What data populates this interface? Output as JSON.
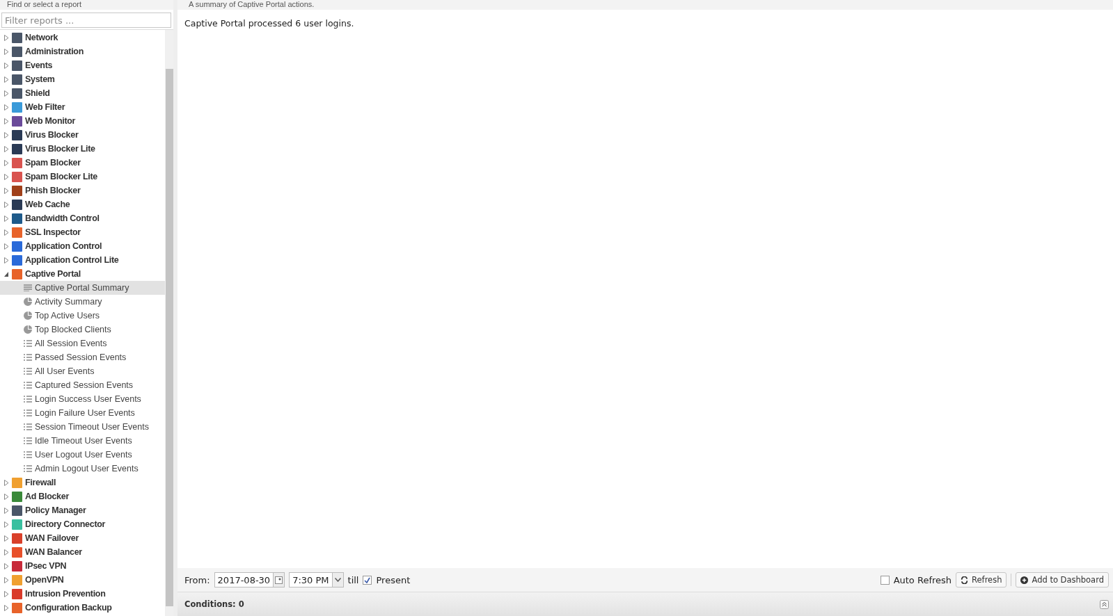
{
  "sidebar": {
    "title": "Find or select a report",
    "filter": {
      "placeholder": "Filter reports ..."
    },
    "items": [
      {
        "label": "Network",
        "color": "#4a5668",
        "expanded": false,
        "selected": false
      },
      {
        "label": "Administration",
        "color": "#4a5668",
        "expanded": false,
        "selected": false
      },
      {
        "label": "Events",
        "color": "#4a5668",
        "expanded": false,
        "selected": false
      },
      {
        "label": "System",
        "color": "#4a5668",
        "expanded": false,
        "selected": false
      },
      {
        "label": "Shield",
        "color": "#4a5668",
        "expanded": false,
        "selected": false
      },
      {
        "label": "Web Filter",
        "color": "#3a9ad9",
        "expanded": false,
        "selected": false
      },
      {
        "label": "Web Monitor",
        "color": "#6a4a9a",
        "expanded": false,
        "selected": false
      },
      {
        "label": "Virus Blocker",
        "color": "#2a3a55",
        "expanded": false,
        "selected": false
      },
      {
        "label": "Virus Blocker Lite",
        "color": "#2a3a55",
        "expanded": false,
        "selected": false
      },
      {
        "label": "Spam Blocker",
        "color": "#d9534f",
        "expanded": false,
        "selected": false
      },
      {
        "label": "Spam Blocker Lite",
        "color": "#d9534f",
        "expanded": false,
        "selected": false
      },
      {
        "label": "Phish Blocker",
        "color": "#a0401a",
        "expanded": false,
        "selected": false
      },
      {
        "label": "Web Cache",
        "color": "#2a3a55",
        "expanded": false,
        "selected": false
      },
      {
        "label": "Bandwidth Control",
        "color": "#1e5a8a",
        "expanded": false,
        "selected": false
      },
      {
        "label": "SSL Inspector",
        "color": "#e8632a",
        "expanded": false,
        "selected": false
      },
      {
        "label": "Application Control",
        "color": "#2a6ad9",
        "expanded": false,
        "selected": false
      },
      {
        "label": "Application Control Lite",
        "color": "#2a6ad9",
        "expanded": false,
        "selected": false
      },
      {
        "label": "Captive Portal",
        "color": "#e8632a",
        "expanded": true,
        "selected": false,
        "children": [
          {
            "label": "Captive Portal Summary",
            "kind": "text",
            "selected": true
          },
          {
            "label": "Activity Summary",
            "kind": "pie",
            "selected": false
          },
          {
            "label": "Top Active Users",
            "kind": "pie",
            "selected": false
          },
          {
            "label": "Top Blocked Clients",
            "kind": "pie",
            "selected": false
          },
          {
            "label": "All Session Events",
            "kind": "list",
            "selected": false
          },
          {
            "label": "Passed Session Events",
            "kind": "list",
            "selected": false
          },
          {
            "label": "All User Events",
            "kind": "list",
            "selected": false
          },
          {
            "label": "Captured Session Events",
            "kind": "list",
            "selected": false
          },
          {
            "label": "Login Success User Events",
            "kind": "list",
            "selected": false
          },
          {
            "label": "Login Failure User Events",
            "kind": "list",
            "selected": false
          },
          {
            "label": "Session Timeout User Events",
            "kind": "list",
            "selected": false
          },
          {
            "label": "Idle Timeout User Events",
            "kind": "list",
            "selected": false
          },
          {
            "label": "User Logout User Events",
            "kind": "list",
            "selected": false
          },
          {
            "label": "Admin Logout User Events",
            "kind": "list",
            "selected": false
          }
        ]
      },
      {
        "label": "Firewall",
        "color": "#f0a030",
        "expanded": false,
        "selected": false
      },
      {
        "label": "Ad Blocker",
        "color": "#3a8a3a",
        "expanded": false,
        "selected": false
      },
      {
        "label": "Policy Manager",
        "color": "#4a5668",
        "expanded": false,
        "selected": false
      },
      {
        "label": "Directory Connector",
        "color": "#3ac0a0",
        "expanded": false,
        "selected": false
      },
      {
        "label": "WAN Failover",
        "color": "#d9402a",
        "expanded": false,
        "selected": false
      },
      {
        "label": "WAN Balancer",
        "color": "#e8502a",
        "expanded": false,
        "selected": false
      },
      {
        "label": "IPsec VPN",
        "color": "#c82a3a",
        "expanded": false,
        "selected": false
      },
      {
        "label": "OpenVPN",
        "color": "#f0a030",
        "expanded": false,
        "selected": false
      },
      {
        "label": "Intrusion Prevention",
        "color": "#d93a2a",
        "expanded": false,
        "selected": false
      },
      {
        "label": "Configuration Backup",
        "color": "#e8632a",
        "expanded": false,
        "selected": false
      }
    ]
  },
  "report": {
    "description": "A summary of Captive Portal actions.",
    "text": "Captive Portal processed 6 user logins."
  },
  "toolbar": {
    "from_label": "From:",
    "date": "2017-08-30",
    "time": "7:30 PM",
    "till_label": "till",
    "present": {
      "label": "Present",
      "checked": true
    },
    "auto_refresh": {
      "label": "Auto Refresh",
      "checked": false
    },
    "refresh_button": "Refresh",
    "dashboard_button": "Add to Dashboard"
  },
  "conditions": {
    "label": "Conditions: 0"
  }
}
